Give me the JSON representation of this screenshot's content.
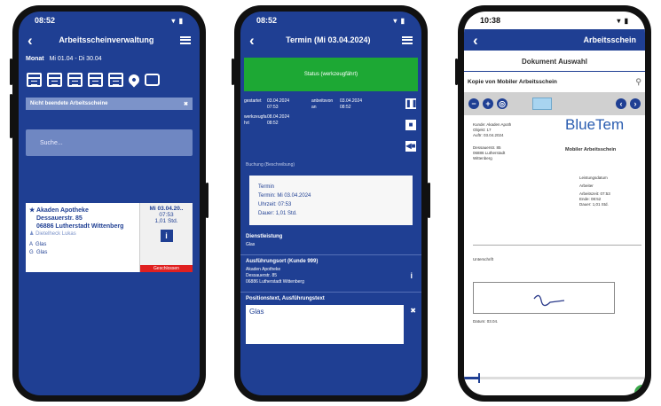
{
  "phone1": {
    "status": {
      "time": "08:52",
      "sys": "▾ ▮"
    },
    "header": {
      "title": "Arbeitsscheinverwaltung",
      "back": "‹"
    },
    "month": {
      "label": "Monat",
      "range": "Mi 01.04 - Di 30.04"
    },
    "dropdown": {
      "value": "Nicht beendete Arbeitsscheine",
      "arrow": "✖"
    },
    "search": {
      "placeholder": "Suche..."
    },
    "card": {
      "star": "★",
      "name": "Akaden Apotheke",
      "street": "Dessauerstr. 85",
      "city": "06886 Lutherstadt Wittenberg",
      "person_icon": "♟",
      "person": "Dietelheck Lukas",
      "item1_code": "A",
      "item1": "Glas",
      "item2_code": "G",
      "item2": "Glas",
      "date": "Mi 03.04.20..",
      "time": "07:53",
      "duration": "1,01 Std.",
      "info_icon": "i",
      "status": "Geschlossen"
    }
  },
  "phone2": {
    "status": {
      "time": "08:52",
      "sys": "▾ ▮"
    },
    "header": {
      "title": "Termin (Mi 03.04.2024)",
      "back": "‹"
    },
    "status_bar": "Status (werkzeugfährt)",
    "meta": {
      "gestartet_label": "gestartet",
      "gestartet_value": "03.04.2024 07:53",
      "beendet_label": "anbeitsvon an",
      "beendet_value": "03.04.2024 08:52",
      "dauer_label": "werkzeugfa hrt",
      "dauer_value": "08.04.2024 08:52"
    },
    "buttons": {
      "pause": "❚❚",
      "stop": "■",
      "extra": "◀■"
    },
    "section_label": "Buchung (Beschreibung)",
    "termin_box": {
      "title": "Termin",
      "line1": "Termin: Mi 03.04.2024",
      "line2": "Uhrzeit: 07:53",
      "line3": "Dauer: 1,01 Std."
    },
    "dienstleistung_label": "Dienstleistung",
    "dienstleistung_value": "Glas",
    "ort_label": "Ausführungsort (Kunde 999)",
    "ort_lines": [
      "Akaden Apotheke",
      "Dessauerstr. 85",
      "06886 Lutherstadt Wittenberg"
    ],
    "ort_info": "i",
    "positionen_label": "Positionstext, Ausführungstext",
    "positionen_value": "Glas",
    "delete_icon": "✖"
  },
  "phone3": {
    "status": {
      "time": "10:38",
      "sys": "▾ ▮"
    },
    "header": {
      "back": "‹",
      "title": "Arbeitsschein"
    },
    "doc_title": "Dokument Auswahl",
    "copy_label": "Kopie von Mobiler Arbeitsschein",
    "toolbar": {
      "minus": "−",
      "plus": "+",
      "reset": "◎",
      "prev": "‹",
      "next": "›"
    },
    "logo": "BlueTem",
    "subtitle": "Mobiler Arbeitsschein",
    "left_text": [
      "Kunde: Akaden Apoth",
      "Objekt: 17",
      "Auftr: 03.04.2024"
    ],
    "left_text2": [
      "Dessauerstr. 85",
      "06886 Lutherstadt",
      "Wittenberg"
    ],
    "right_text": [
      "Leistungsdatum",
      "Arbeiter",
      "Arbeitszeit: 07:53",
      "Ende: 08:52",
      "Dauer: 1,01 Std."
    ],
    "sig_label": "Unterschrift",
    "date_label": "Datum: 03.04.",
    "slider_value": 0.08
  }
}
